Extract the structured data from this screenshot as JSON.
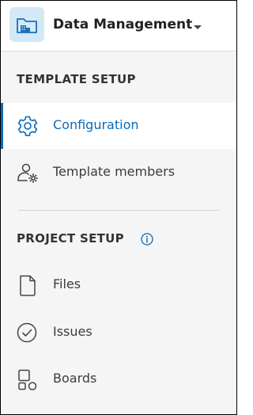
{
  "header": {
    "title": "Data Management",
    "logo_icon": "folder-building-icon",
    "dropdown_icon": "caret-down-icon"
  },
  "template_setup": {
    "heading": "TEMPLATE SETUP",
    "items": [
      {
        "label": "Configuration",
        "icon": "gear-icon",
        "active": true
      },
      {
        "label": "Template members",
        "icon": "user-gear-icon",
        "active": false
      }
    ]
  },
  "project_setup": {
    "heading": "PROJECT SETUP",
    "info_icon": "info-icon",
    "items": [
      {
        "label": "Files",
        "icon": "file-icon",
        "active": false
      },
      {
        "label": "Issues",
        "icon": "check-circle-icon",
        "active": false
      },
      {
        "label": "Boards",
        "icon": "boards-icon",
        "active": false
      }
    ]
  },
  "colors": {
    "accent": "#0a6ab8",
    "logo_bg": "#d3e9f7",
    "sidebar_bg": "#f5f5f5",
    "active_bg": "#ffffff"
  }
}
